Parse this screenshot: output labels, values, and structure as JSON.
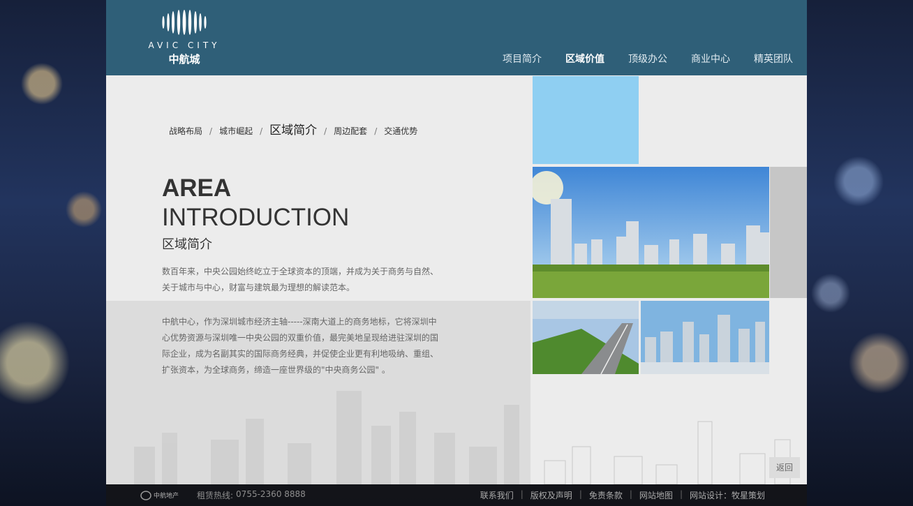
{
  "brand": {
    "name_en": "AVIC CITY",
    "name_cn": "中航城"
  },
  "nav": [
    {
      "label": "项目简介",
      "active": false
    },
    {
      "label": "区域价值",
      "active": true
    },
    {
      "label": "顶级办公",
      "active": false
    },
    {
      "label": "商业中心",
      "active": false
    },
    {
      "label": "精英团队",
      "active": false
    }
  ],
  "subnav": [
    {
      "label": "战略布局",
      "active": false
    },
    {
      "label": "城市崛起",
      "active": false
    },
    {
      "label": "区域简介",
      "active": true
    },
    {
      "label": "周边配套",
      "active": false
    },
    {
      "label": "交通优势",
      "active": false
    }
  ],
  "subnav_sep": "/",
  "heading": {
    "en_line1": "AREA",
    "en_line2": "INTRODUCTION",
    "cn": "区域简介"
  },
  "paragraphs": {
    "p1": "数百年来，中央公园始终屹立于全球资本的顶端，并成为关于商务与自然、关于城市与中心，财富与建筑最为理想的解读范本。",
    "p2": "中航中心，作为深圳城市经济主轴-----深南大道上的商务地标，它将深圳中心优势资源与深圳唯一中央公园的双重价值，最完美地呈现给进驻深圳的国际企业，成为名副其实的国际商务经典，并促使企业更有利地吸纳、重组、扩张资本，为全球商务，缔造一座世界级的\"中央商务公园\" 。"
  },
  "back_label": "返回",
  "footer": {
    "logo_text": "中航地产",
    "hotline_label": "租赁热线:",
    "hotline_number": "0755-2360 8888",
    "links": [
      "联系我们",
      "版权及声明",
      "免责条款",
      "网站地图",
      "网站设计：牧星策划"
    ],
    "sep": "|"
  },
  "colors": {
    "header": "#2f5f78",
    "accent_block": "#8fcff2",
    "panel": "#ececec"
  }
}
